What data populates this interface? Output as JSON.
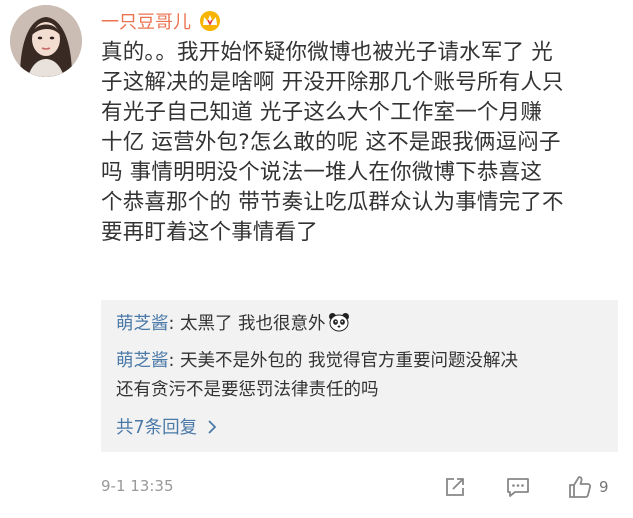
{
  "comment": {
    "username": "一只豆哥儿",
    "badge_icon": "crown-vip-icon",
    "text_lines": [
      "真的。。我开始怀疑你微博也被光子请水军了 光",
      "子这解决的是啥啊 开没开除那几个账号所有人只",
      "有光子自己知道  光子这么大个工作室一个月赚",
      "十亿  运营外包?怎么敢的呢  这不是跟我俩逗闷子",
      "吗   事情明明没个说法一堆人在你微博下恭喜这",
      "个恭喜那个的  带节奏让吃瓜群众认为事情完了不",
      "要再盯着这个事情看了"
    ]
  },
  "replies": [
    {
      "author": "萌芝酱",
      "sep": ": ",
      "text": "太黑了 我也很意外",
      "emoji": "panda-emoji"
    },
    {
      "author": "萌芝酱",
      "sep": ": ",
      "text_lines": [
        "天美不是外包的 我觉得官方重要问题没解决",
        "还有贪污不是要惩罚法律责任的吗"
      ]
    }
  ],
  "more_replies_label": "共7条回复",
  "footer": {
    "timestamp": "9-1 13:35",
    "like_count": "9"
  },
  "colors": {
    "username": "#eb7350",
    "link": "#4a79a8",
    "reply_bg": "#f2f2f2"
  }
}
